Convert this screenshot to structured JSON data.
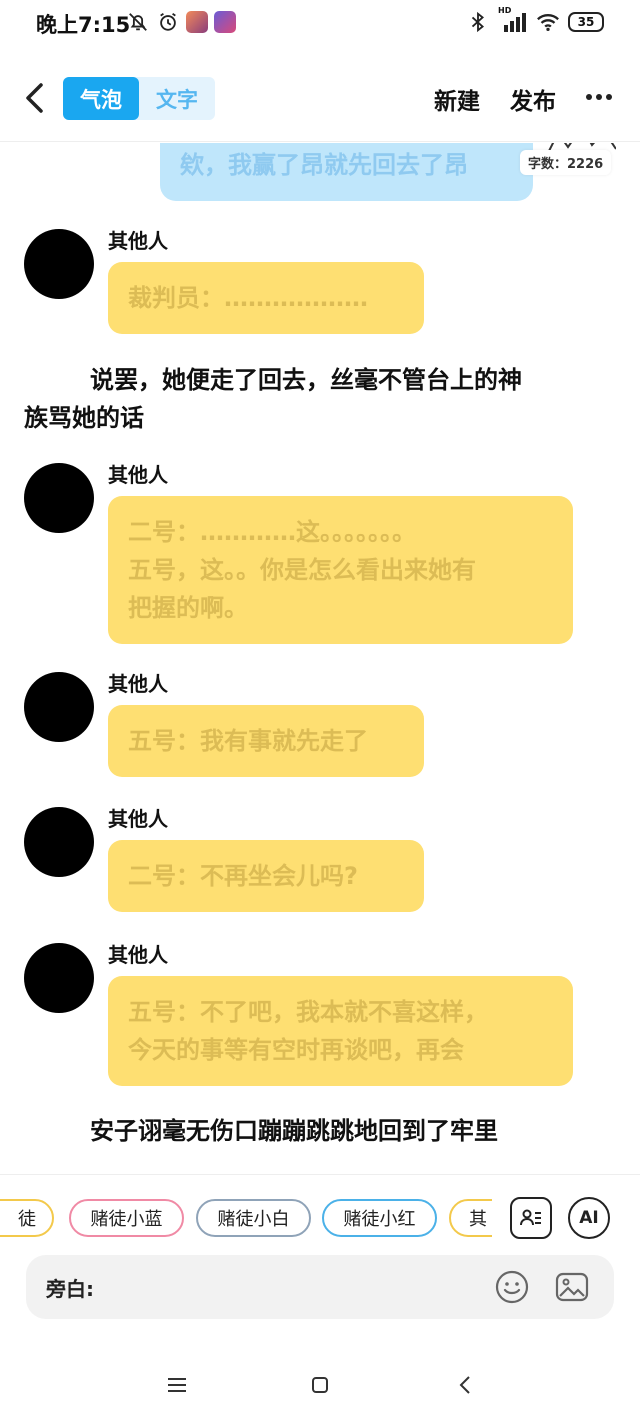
{
  "status_bar": {
    "time": "晚上7:15",
    "battery": "35",
    "network_label": "HD"
  },
  "nav": {
    "tabs": [
      {
        "label": "气泡",
        "active": true
      },
      {
        "label": "文字",
        "active": false
      }
    ],
    "new_label": "新建",
    "publish_label": "发布"
  },
  "top_bubble": {
    "text": "欸，我赢了昂就先回去了昂",
    "word_count": "字数：2226"
  },
  "messages": [
    {
      "sender": "其他人",
      "lines": [
        "裁判员：………………"
      ]
    },
    {
      "sender": "其他人",
      "lines": [
        "二号：…………这。。。。。。。",
        "五号，这。。你是怎么看出来她有",
        "把握的啊。"
      ]
    },
    {
      "sender": "其他人",
      "lines": [
        "五号：我有事就先走了"
      ]
    },
    {
      "sender": "其他人",
      "lines": [
        "二号：不再坐会儿吗?"
      ]
    },
    {
      "sender": "其他人",
      "lines": [
        "五号：不了吧，我本就不喜这样，",
        "今天的事等有空时再谈吧，再会"
      ]
    }
  ],
  "narrations": [
    {
      "lines": [
        "说罢，她便走了回去，丝毫不管台上的神",
        "族骂她的话"
      ]
    },
    {
      "lines": [
        "安子诩毫无伤口蹦蹦跳跳地回到了牢里"
      ]
    }
  ],
  "role_chips": [
    {
      "label": "徒",
      "color": "#f3c94b"
    },
    {
      "label": "赌徒小蓝",
      "color": "#f08aa5"
    },
    {
      "label": "赌徒小白",
      "color": "#8fa3b8"
    },
    {
      "label": "赌徒小红",
      "color": "#4bb1e8"
    },
    {
      "label": "其",
      "color": "#f3c94b"
    }
  ],
  "ai_label": "AI",
  "input": {
    "label": "旁白:",
    "value": ""
  },
  "colors": {
    "accent": "#1aa7f0",
    "bubble_yellow": "#fedf72",
    "bubble_blue": "#bfe6fb"
  }
}
